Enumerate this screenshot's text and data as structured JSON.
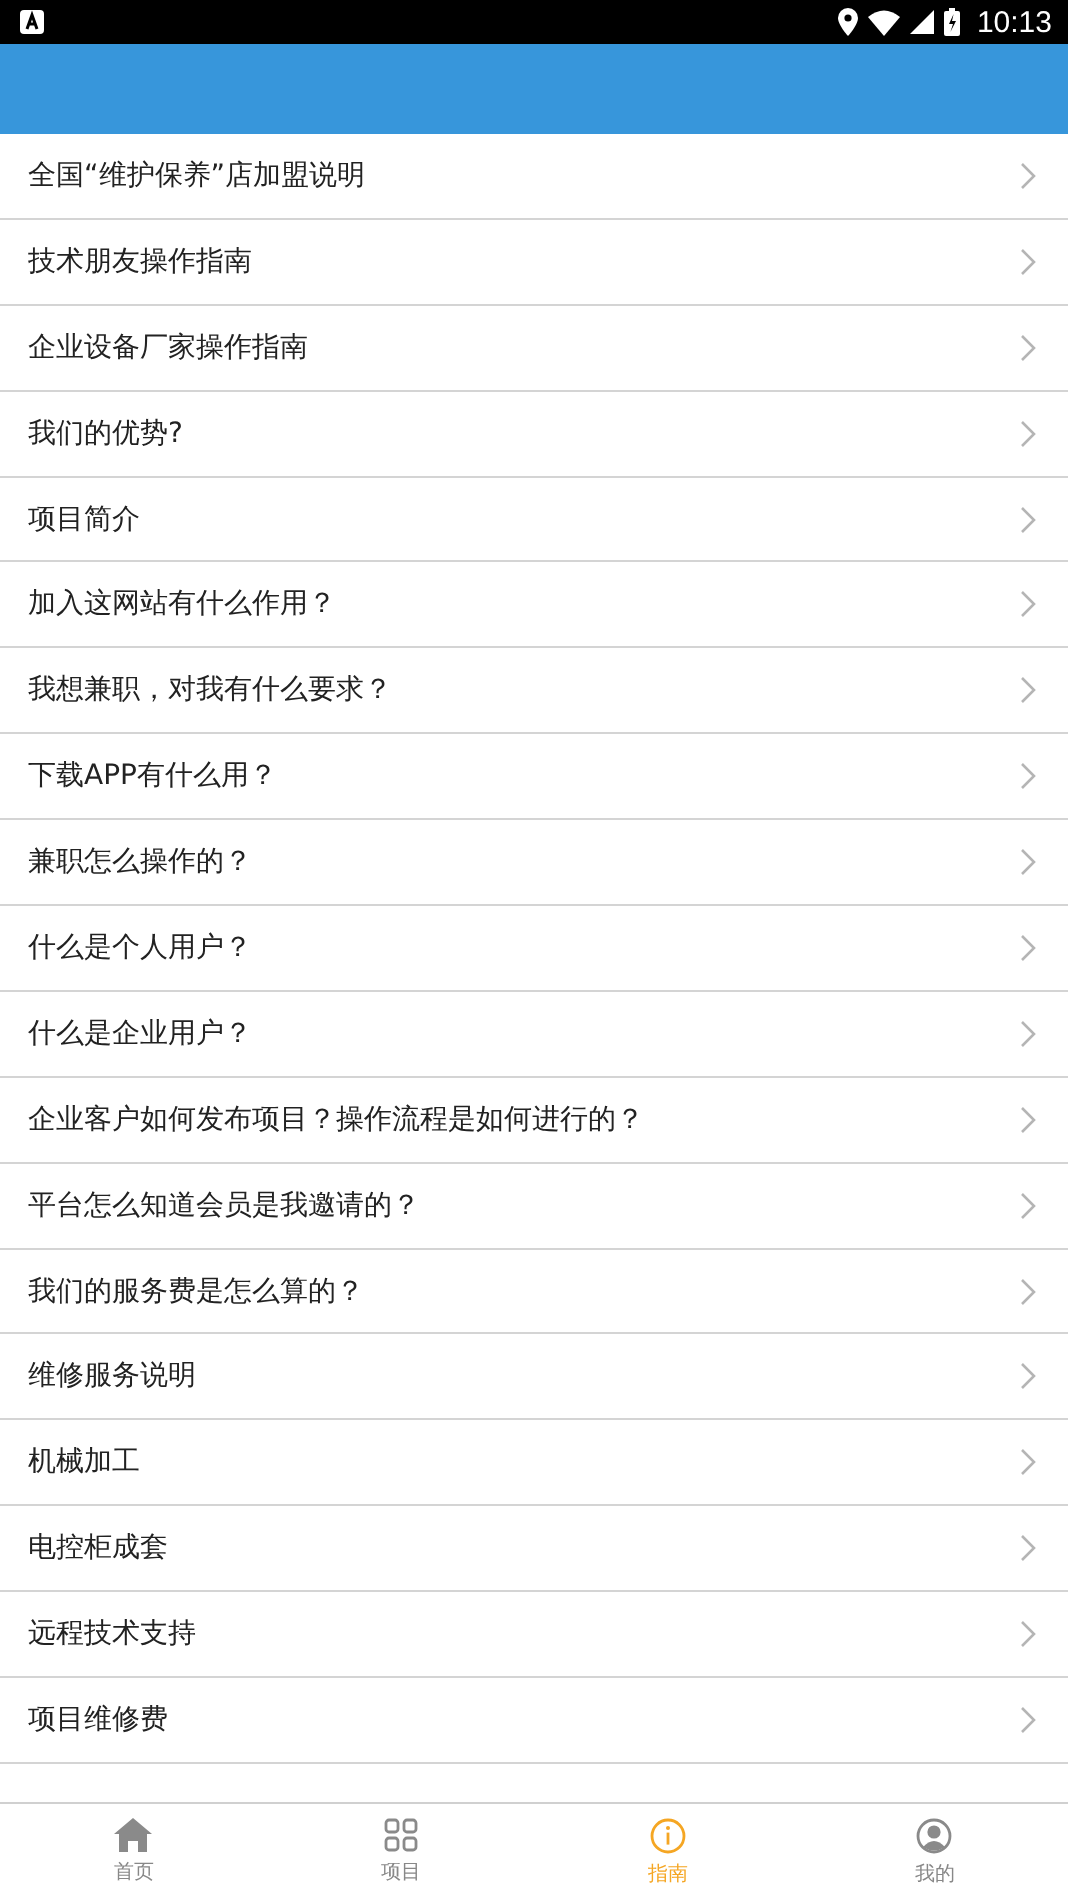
{
  "status_bar": {
    "time": "10:13"
  },
  "list": [
    {
      "label": "全国“维护保养”店加盟说明"
    },
    {
      "label": "技术朋友操作指南"
    },
    {
      "label": "企业设备厂家操作指南"
    },
    {
      "label": "我们的优势?"
    },
    {
      "label": "项目简介"
    },
    {
      "label": "加入这网站有什么作用？"
    },
    {
      "label": "我想兼职，对我有什么要求？"
    },
    {
      "label": "下载APP有什么用？"
    },
    {
      "label": "兼职怎么操作的？"
    },
    {
      "label": "什么是个人用户？"
    },
    {
      "label": "什么是企业用户？"
    },
    {
      "label": "企业客户如何发布项目？操作流程是如何进行的？"
    },
    {
      "label": "平台怎么知道会员是我邀请的？"
    },
    {
      "label": "我们的服务费是怎么算的？"
    },
    {
      "label": "维修服务说明"
    },
    {
      "label": "机械加工"
    },
    {
      "label": "电控柜成套"
    },
    {
      "label": "远程技术支持"
    },
    {
      "label": "项目维修费"
    }
  ],
  "bottom_nav": [
    {
      "kind": "home",
      "label": "首页",
      "selected": false
    },
    {
      "kind": "grid",
      "label": "项目",
      "selected": false
    },
    {
      "kind": "info",
      "label": "指南",
      "selected": true
    },
    {
      "kind": "user",
      "label": "我的",
      "selected": false
    }
  ]
}
